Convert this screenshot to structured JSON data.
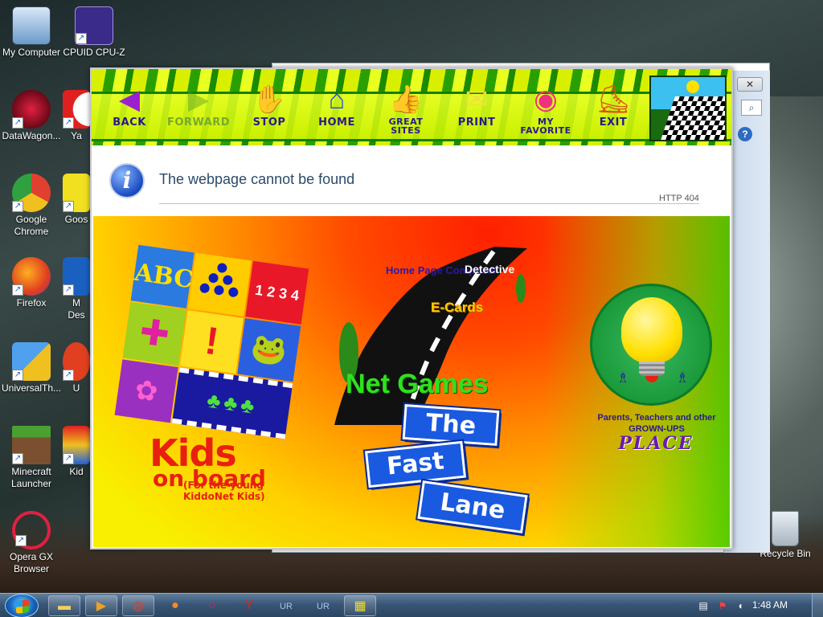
{
  "desktop": {
    "icons": [
      {
        "label": "My Computer",
        "icon": "computer-icon"
      },
      {
        "label": "CPUID CPU-Z",
        "icon": "cpu-chip-icon"
      },
      {
        "label": "DataWagon...",
        "icon": "datawagon-icon"
      },
      {
        "label": "Ya",
        "icon": "yandex-icon"
      },
      {
        "label": "Google Chrome",
        "icon": "chrome-icon"
      },
      {
        "label": "Goos",
        "icon": "goose-icon"
      },
      {
        "label": "Firefox",
        "icon": "firefox-icon"
      },
      {
        "label": "M Des",
        "icon": "app-icon"
      },
      {
        "label": "UniversalTh...",
        "icon": "shield-icon"
      },
      {
        "label": "U",
        "icon": "app-icon"
      },
      {
        "label": "Minecraft Launcher",
        "icon": "minecraft-icon"
      },
      {
        "label": "Kid",
        "icon": "kids-icon"
      },
      {
        "label": "Opera GX Browser",
        "icon": "opera-icon"
      },
      {
        "label": "Recycle Bin",
        "icon": "recycle-bin-icon"
      }
    ]
  },
  "background_window": {
    "close_label": "✕",
    "search_icon": "search-icon",
    "help_label": "?"
  },
  "kids_window": {
    "toolbar": [
      {
        "label": "BACK",
        "icon": "back-arrow-icon",
        "enabled": true
      },
      {
        "label": "FORWARD",
        "icon": "forward-arrow-icon",
        "enabled": false
      },
      {
        "label": "STOP",
        "icon": "stop-hand-icon",
        "enabled": true
      },
      {
        "label": "HOME",
        "icon": "home-icon",
        "enabled": true
      },
      {
        "label": "GREAT SITES",
        "icon": "thumbs-up-icon",
        "enabled": true
      },
      {
        "label": "PRINT",
        "icon": "print-icon",
        "enabled": true
      },
      {
        "label": "MY FAVORITE",
        "icon": "lollipop-icon",
        "enabled": true
      },
      {
        "label": "EXIT",
        "icon": "skateboard-icon",
        "enabled": true
      }
    ],
    "error": {
      "title": "The webpage cannot be found",
      "code": "HTTP 404"
    },
    "page": {
      "kids_title": "Kids",
      "kids_sub": "on board",
      "kids_paren": "(For the young KiddoNet Kids)",
      "link_home_page": "Home Page Composer",
      "link_detective": "Detective",
      "link_ecards": "E-Cards",
      "link_net_games": "Net Games",
      "sign_the": "The",
      "sign_fast": "Fast",
      "sign_lane": "Lane",
      "parents_text": "Parents, Teachers and other GROWN-UPS",
      "place_text": "PLACE"
    }
  },
  "taskbar": {
    "items": [
      "explorer-icon",
      "media-player-icon",
      "chrome-icon",
      "firefox-icon",
      "opera-icon",
      "yandex-icon",
      "ur-browser-icon",
      "ur-browser-icon",
      "kids-browser-icon"
    ],
    "clock": "1:48 AM"
  }
}
